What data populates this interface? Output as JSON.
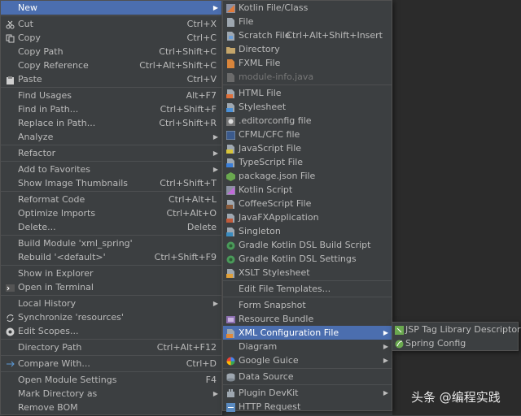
{
  "colors": {
    "menu_bg": "#3c3f41",
    "selected": "#4b6eaf",
    "text": "#bbbbbb",
    "disabled": "#777777",
    "editor_bg": "#2b2b2b"
  },
  "context_menu": {
    "groups": [
      [
        {
          "label": "New",
          "has_submenu": true,
          "selected": true
        }
      ],
      [
        {
          "label": "Cut",
          "shortcut": "Ctrl+X",
          "icon": "scissors-icon"
        },
        {
          "label": "Copy",
          "shortcut": "Ctrl+C",
          "icon": "copy-icon"
        },
        {
          "label": "Copy Path",
          "shortcut": "Ctrl+Shift+C"
        },
        {
          "label": "Copy Reference",
          "shortcut": "Ctrl+Alt+Shift+C"
        },
        {
          "label": "Paste",
          "shortcut": "Ctrl+V",
          "icon": "paste-icon"
        }
      ],
      [
        {
          "label": "Find Usages",
          "shortcut": "Alt+F7"
        },
        {
          "label": "Find in Path...",
          "shortcut": "Ctrl+Shift+F"
        },
        {
          "label": "Replace in Path...",
          "shortcut": "Ctrl+Shift+R"
        },
        {
          "label": "Analyze",
          "has_submenu": true
        }
      ],
      [
        {
          "label": "Refactor",
          "has_submenu": true
        }
      ],
      [
        {
          "label": "Add to Favorites",
          "has_submenu": true
        },
        {
          "label": "Show Image Thumbnails",
          "shortcut": "Ctrl+Shift+T"
        }
      ],
      [
        {
          "label": "Reformat Code",
          "shortcut": "Ctrl+Alt+L"
        },
        {
          "label": "Optimize Imports",
          "shortcut": "Ctrl+Alt+O"
        },
        {
          "label": "Delete...",
          "shortcut": "Delete"
        }
      ],
      [
        {
          "label": "Build Module 'xml_spring'"
        },
        {
          "label": "Rebuild '<default>'",
          "shortcut": "Ctrl+Shift+F9"
        }
      ],
      [
        {
          "label": "Show in Explorer"
        },
        {
          "label": "Open in Terminal",
          "icon": "terminal-icon"
        }
      ],
      [
        {
          "label": "Local History",
          "has_submenu": true
        },
        {
          "label": "Synchronize 'resources'",
          "icon": "sync-icon"
        },
        {
          "label": "Edit Scopes...",
          "icon": "scopes-icon"
        }
      ],
      [
        {
          "label": "Directory Path",
          "shortcut": "Ctrl+Alt+F12"
        }
      ],
      [
        {
          "label": "Compare With...",
          "shortcut": "Ctrl+D",
          "icon": "compare-icon"
        }
      ],
      [
        {
          "label": "Open Module Settings",
          "shortcut": "F4"
        },
        {
          "label": "Mark Directory as",
          "has_submenu": true
        },
        {
          "label": "Remove BOM"
        }
      ]
    ]
  },
  "new_submenu": {
    "groups": [
      [
        {
          "label": "Kotlin File/Class",
          "icon": "kotlin-file-icon"
        },
        {
          "label": "File",
          "icon": "file-icon"
        },
        {
          "label": "Scratch File",
          "shortcut": "Ctrl+Alt+Shift+Insert",
          "icon": "scratch-file-icon"
        },
        {
          "label": "Directory",
          "icon": "folder-icon"
        },
        {
          "label": "FXML File",
          "icon": "fxml-file-icon"
        },
        {
          "label": "module-info.java",
          "icon": "module-info-icon",
          "disabled": true
        }
      ],
      [
        {
          "label": "HTML File",
          "icon": "html-file-icon"
        },
        {
          "label": "Stylesheet",
          "icon": "stylesheet-icon"
        },
        {
          "label": ".editorconfig file",
          "icon": "editorconfig-icon"
        },
        {
          "label": "CFML/CFC file",
          "icon": "cfml-icon"
        },
        {
          "label": "JavaScript File",
          "icon": "javascript-file-icon"
        },
        {
          "label": "TypeScript File",
          "icon": "typescript-file-icon"
        },
        {
          "label": "package.json File",
          "icon": "package-json-icon"
        },
        {
          "label": "Kotlin Script",
          "icon": "kotlin-script-icon"
        },
        {
          "label": "CoffeeScript File",
          "icon": "coffeescript-icon"
        },
        {
          "label": "JavaFXApplication",
          "icon": "javafx-icon"
        },
        {
          "label": "Singleton",
          "icon": "singleton-icon"
        },
        {
          "label": "Gradle Kotlin DSL Build Script",
          "icon": "gradle-icon"
        },
        {
          "label": "Gradle Kotlin DSL Settings",
          "icon": "gradle-icon"
        },
        {
          "label": "XSLT Stylesheet",
          "icon": "xslt-icon"
        }
      ],
      [
        {
          "label": "Edit File Templates..."
        }
      ],
      [
        {
          "label": "Form Snapshot"
        },
        {
          "label": "Resource Bundle",
          "icon": "resource-bundle-icon"
        },
        {
          "label": "XML Configuration File",
          "icon": "xml-config-icon",
          "has_submenu": true,
          "selected": true
        },
        {
          "label": "Diagram",
          "has_submenu": true
        },
        {
          "label": "Google Guice",
          "icon": "google-icon",
          "has_submenu": true
        }
      ],
      [
        {
          "label": "Data Source",
          "icon": "database-icon"
        }
      ],
      [
        {
          "label": "Plugin DevKit",
          "icon": "plugin-icon",
          "has_submenu": true
        },
        {
          "label": "HTTP Request",
          "icon": "http-request-icon"
        }
      ]
    ]
  },
  "xml_submenu": {
    "items": [
      {
        "label": "JSP Tag Library Descriptor",
        "icon": "jsp-tag-icon"
      },
      {
        "label": "Spring Config",
        "icon": "spring-icon"
      }
    ]
  },
  "watermark": "头条 @编程实践"
}
